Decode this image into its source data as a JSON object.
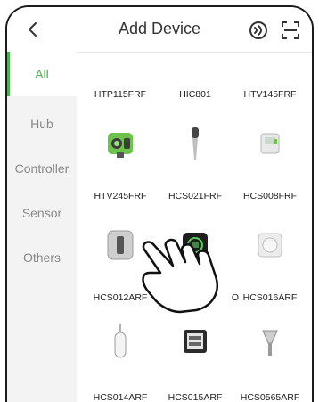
{
  "header": {
    "back_icon": "chevron-left-icon",
    "title": "Add Device",
    "icons": [
      "device-search-icon",
      "scan-icon"
    ]
  },
  "sidebar": {
    "items": [
      {
        "label": "All",
        "active": true
      },
      {
        "label": "Hub",
        "active": false
      },
      {
        "label": "Controller",
        "active": false
      },
      {
        "label": "Sensor",
        "active": false
      },
      {
        "label": "Others",
        "active": false
      }
    ]
  },
  "devices": {
    "row0": [
      "HTP115FRF",
      "HIC801",
      "HTV145FRF"
    ],
    "row1": [
      "HTV245FRF",
      "HCS021FRF",
      "HCS008FRF"
    ],
    "row2": [
      "HCS012ARF",
      "O",
      "HCS016ARF"
    ],
    "row3": [
      "HCS014ARF",
      "HCS015ARF",
      "HCS0565ARF"
    ]
  },
  "colors": {
    "accent": "#4caf50"
  }
}
